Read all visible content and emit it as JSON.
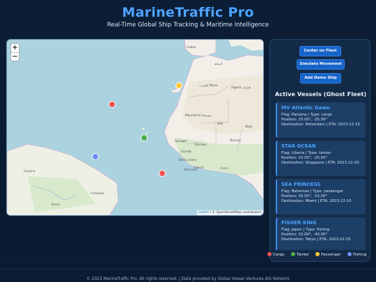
{
  "header": {
    "title": "MarineTraffic Pro",
    "subtitle": "Real-Time Global Ship Tracking & Maritime Intelligence"
  },
  "map": {
    "zoom_in": "+",
    "zoom_out": "−",
    "attribution_leaflet": "Leaflet",
    "attribution_osm": "| © OpenStreetMap contributors",
    "places": {
      "lisboa": "Lisboa",
      "rabat": "الرباط",
      "algeria": "Algérie الجزائر",
      "morocco": "المغرب Maroc",
      "mauritania": "Mauritanie موريتانيا",
      "mali": "Mali",
      "niger": "Niger",
      "senegal": "Sénégal",
      "guinea": "Guinée",
      "bamako": "Bamako",
      "niamey": "Niamey",
      "sierra": "Sierra Leone",
      "liberia": "Liberia",
      "monrovia": "Monrovia",
      "accra": "Accra",
      "fortaleza": "Fortaleza",
      "brasil": "Brasil",
      "guyana": "Guyana"
    }
  },
  "controls": {
    "center_fleet": "Center on Fleet",
    "simulate": "Simulate Movement",
    "add_demo": "Add Demo Ship"
  },
  "vessels_heading": "Active Vessels (Ghost Fleet)",
  "vessels": [
    {
      "name": "MV Atlantic Dawn",
      "line1": "Flag: Panama | Type: cargo",
      "line2": "Position: 25.00°, -35.00°",
      "line3": "Destination: Rotterdam | ETA: 2023-12-15",
      "type": "cargo"
    },
    {
      "name": "STAR OCEAN",
      "line1": "Flag: Liberia | Type: tanker",
      "line2": "Position: 15.50°, -25.50°",
      "line3": "Destination: Singapore | ETA: 2023-12-20",
      "type": "tanker"
    },
    {
      "name": "SEA PRINCESS",
      "line1": "Flag: Bahamas | Type: passenger",
      "line2": "Position: 30.00°, -15.00°",
      "line3": "Destination: Miami | ETA: 2023-12-10",
      "type": "passenger"
    },
    {
      "name": "FISHER KING",
      "line1": "Flag: Japan | Type: fishing",
      "line2": "Position: 10.00°, -40.00°",
      "line3": "Destination: Tokyo | ETA: 2023-12-25",
      "type": "fishing"
    }
  ],
  "legend": [
    {
      "label": "Cargo",
      "color": "#ef5350"
    },
    {
      "label": "Tanker",
      "color": "#4caf50"
    },
    {
      "label": "Passenger",
      "color": "#ffc83d"
    },
    {
      "label": "Fishing",
      "color": "#6f8cf7"
    }
  ],
  "footer": "© 2023 MarineTraffic Pro. All rights reserved. | Data provided by Global Vessel Ventures AIS Network"
}
